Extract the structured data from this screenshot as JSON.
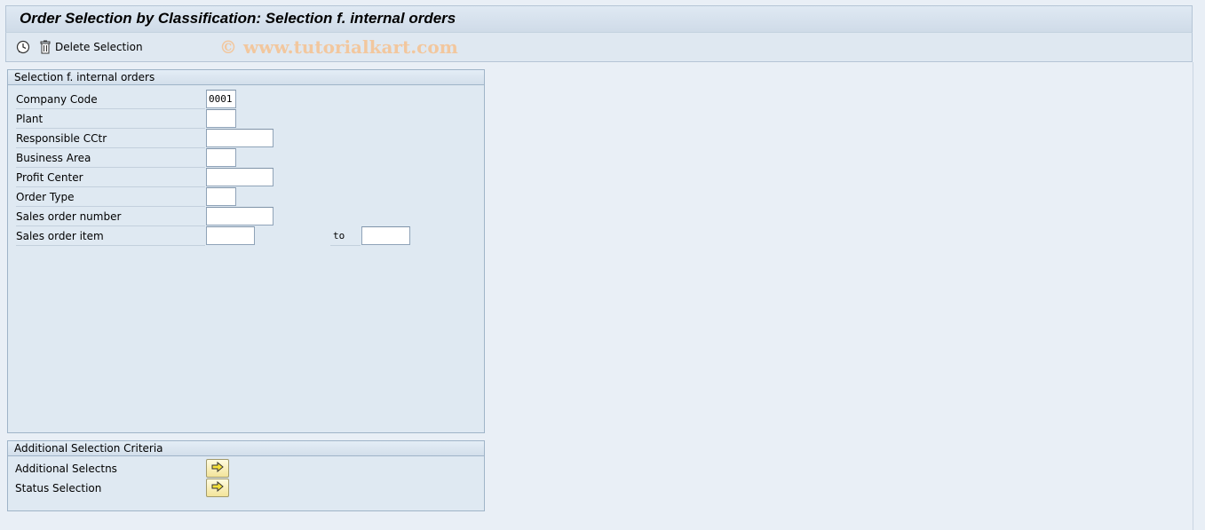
{
  "window": {
    "title": "Order Selection by Classification: Selection f. internal orders"
  },
  "toolbar": {
    "execute_icon": "execute-clock-icon",
    "delete_icon": "trash-icon",
    "delete_label": "Delete Selection",
    "watermark": "© www.tutorialkart.com"
  },
  "group_selection": {
    "title": "Selection f. internal orders",
    "fields": [
      {
        "label": "Company Code",
        "value": "0001"
      },
      {
        "label": "Plant",
        "value": ""
      },
      {
        "label": "Responsible CCtr",
        "value": ""
      },
      {
        "label": "Business Area",
        "value": ""
      },
      {
        "label": "Profit Center",
        "value": ""
      },
      {
        "label": "Order Type",
        "value": ""
      },
      {
        "label": "Sales order number",
        "value": ""
      },
      {
        "label": "Sales order item",
        "value": "",
        "to_label": "to",
        "to_value": ""
      }
    ]
  },
  "group_additional": {
    "title": "Additional Selection Criteria",
    "items": [
      {
        "label": "Additional Selectns",
        "icon": "arrow-right-icon"
      },
      {
        "label": "Status Selection",
        "icon": "arrow-right-icon"
      }
    ]
  },
  "colors": {
    "background": "#e9eff6",
    "group_bg": "#dfe9f2",
    "button_yellow": "#f3e49a"
  }
}
